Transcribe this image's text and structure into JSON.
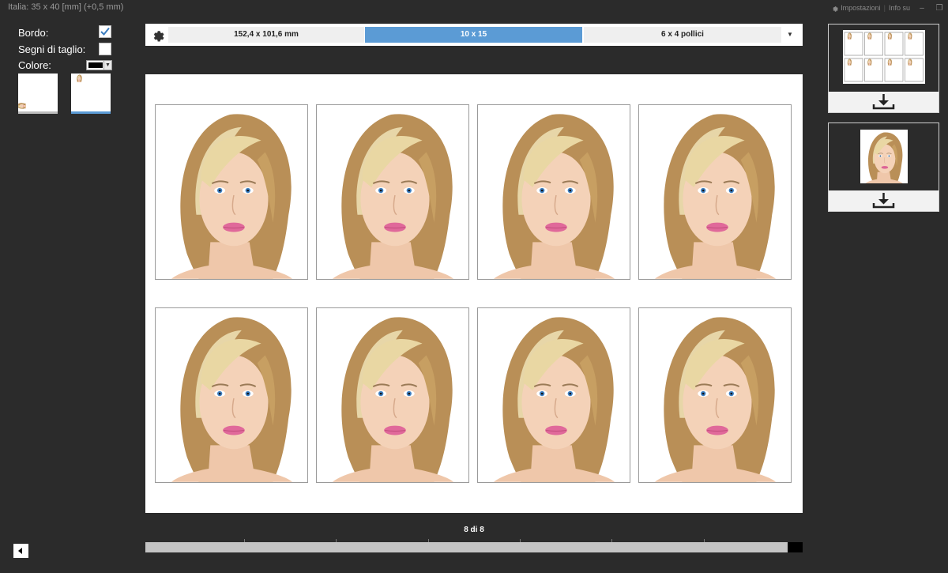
{
  "window": {
    "title": "Italia: 35 x 40 [mm] (+0,5 mm)",
    "settings_label": "Impostazioni",
    "info_label": "Info su",
    "separator": "|",
    "minimize_glyph": "–",
    "restore_glyph": "❐"
  },
  "options": {
    "border_label": "Bordo:",
    "border_checked": true,
    "cut_marks_label": "Segni di taglio:",
    "cut_marks_checked": false,
    "color_label": "Colore:",
    "color_value": "#000000"
  },
  "orientation": {
    "items": [
      "landscape",
      "portrait"
    ],
    "selected": "portrait",
    "accent": "#5b9bd5"
  },
  "size_tabs": [
    {
      "label": "152,4 x 101,6 mm",
      "active": false
    },
    {
      "label": "10 x 15",
      "active": true
    },
    {
      "label": "6 x 4 pollici",
      "active": false
    }
  ],
  "sheet": {
    "rows": 2,
    "cols": 4,
    "photo_count": 8
  },
  "pager": {
    "label": "8 di 8",
    "progress": 1.0
  },
  "icons": {
    "settings": "gear-icon",
    "dropdown": "chevron-down-icon",
    "download": "download-icon",
    "back": "chevron-left-icon",
    "check": "check-icon"
  },
  "colors": {
    "background": "#2b2b2b",
    "accent": "#5b9bd5",
    "sheet": "#ffffff"
  }
}
